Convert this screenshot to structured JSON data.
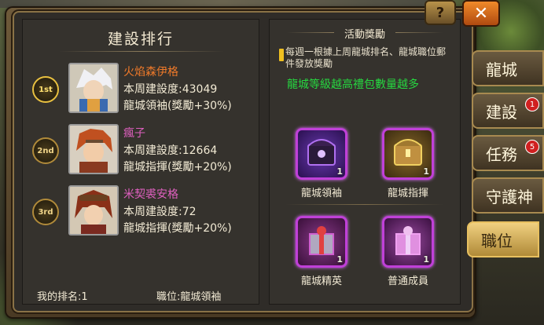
{
  "header": {
    "help_label": "?",
    "close_label": "✕"
  },
  "leaderboard": {
    "title": "建設排行",
    "entries": [
      {
        "rank": "1st",
        "name": "火焰森伊格",
        "name_color": "#f07a2a",
        "score": "本周建設度:43049",
        "role": "龍城領袖(獎勵+30%)"
      },
      {
        "rank": "2nd",
        "name": "瘋子",
        "name_color": "#e060c0",
        "score": "本周建設度:12664",
        "role": "龍城指揮(獎勵+20%)"
      },
      {
        "rank": "3rd",
        "name": "米契裘安格",
        "name_color": "#e060c0",
        "score": "本周建設度:72",
        "role": "龍城指揮(獎勵+20%)"
      }
    ],
    "my_rank": "我的排名:1",
    "my_position": "職位:龍城領袖"
  },
  "rewards": {
    "title": "活動獎勵",
    "notice": "每週一根據上周龍城排名、龍城職位郵件發放獎勵",
    "highlight": "龍城等級越高禮包數量越多",
    "items": [
      {
        "label": "龍城領袖",
        "count": "1",
        "color": "#7a2ad0"
      },
      {
        "label": "龍城指揮",
        "count": "1",
        "color": "#b08a30"
      },
      {
        "label": "龍城精英",
        "count": "1",
        "color": "#c050c0"
      },
      {
        "label": "普通成員",
        "count": "1",
        "color": "#d070d0"
      }
    ]
  },
  "side_tabs": [
    {
      "label": "龍城",
      "badge": ""
    },
    {
      "label": "建設",
      "badge": "1"
    },
    {
      "label": "任務",
      "badge": "5"
    },
    {
      "label": "守護神",
      "badge": ""
    },
    {
      "label": "職位",
      "badge": ""
    }
  ]
}
